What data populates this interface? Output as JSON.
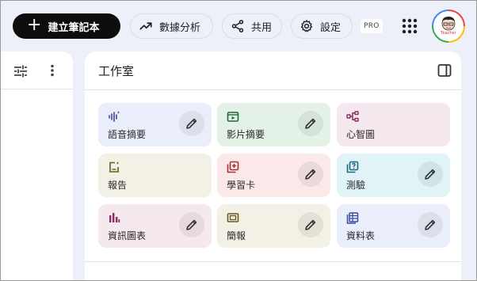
{
  "topbar": {
    "new_notebook_label": "建立筆記本",
    "analytics_label": "數據分析",
    "share_label": "共用",
    "settings_label": "設定",
    "pro_badge": "PRO",
    "avatar_caption": "Teacher"
  },
  "studio": {
    "title": "工作室",
    "cards": [
      {
        "label": "語音摘要",
        "icon": "audio-waveform-icon",
        "color": "#eaeefb",
        "accent": "#3c4a9e"
      },
      {
        "label": "影片摘要",
        "icon": "video-icon",
        "color": "#e3f1e7",
        "accent": "#1e6b3a"
      },
      {
        "label": "心智圖",
        "icon": "mind-map-icon",
        "color": "#f6e8ef",
        "accent": "#8a2f64"
      },
      {
        "label": "報告",
        "icon": "report-icon",
        "color": "#f3f1e5",
        "accent": "#6b5a1e"
      },
      {
        "label": "學習卡",
        "icon": "flashcard-icon",
        "color": "#fbe9e9",
        "accent": "#a3323a"
      },
      {
        "label": "測驗",
        "icon": "quiz-icon",
        "color": "#e0f3f7",
        "accent": "#1c6b7a"
      },
      {
        "label": "資訊圖表",
        "icon": "infographic-icon",
        "color": "#f6e8ef",
        "accent": "#8a2f64"
      },
      {
        "label": "簡報",
        "icon": "slides-icon",
        "color": "#f3f1e5",
        "accent": "#6b5a1e"
      },
      {
        "label": "資料表",
        "icon": "table-icon",
        "color": "#eaeefb",
        "accent": "#3c4a9e"
      }
    ]
  }
}
